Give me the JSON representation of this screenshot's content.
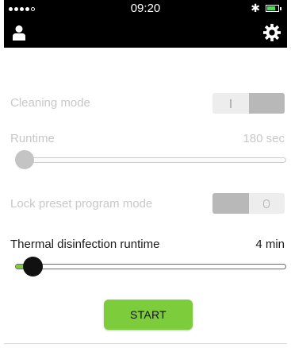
{
  "status_bar": {
    "time": "09:20",
    "signal_icon": "signal-dots-icon",
    "bluetooth_icon": "bluetooth-icon",
    "battery_icon": "battery-icon",
    "battery_color": "#4cd964",
    "battery_level": 0.75
  },
  "nav": {
    "user_icon": "user-icon",
    "settings_icon": "gear-icon"
  },
  "settings": {
    "cleaning_mode": {
      "label": "Cleaning mode",
      "off_glyph": "I",
      "state": "on",
      "enabled": false
    },
    "runtime": {
      "label": "Runtime",
      "value": "180 sec",
      "level": 0,
      "enabled": false
    },
    "lock_preset": {
      "label": "Lock preset program mode",
      "off_glyph": "O",
      "state": "off",
      "enabled": false
    },
    "thermal": {
      "label": "Thermal disinfection runtime",
      "value": "4 min",
      "level": 0.03,
      "enabled": true
    }
  },
  "start_button": {
    "label": "START",
    "color": "#7dcc3b"
  },
  "colors": {
    "accent_green": "#7dcc3b",
    "disabled_text": "#c8c8c8",
    "bar_black": "#000000"
  }
}
